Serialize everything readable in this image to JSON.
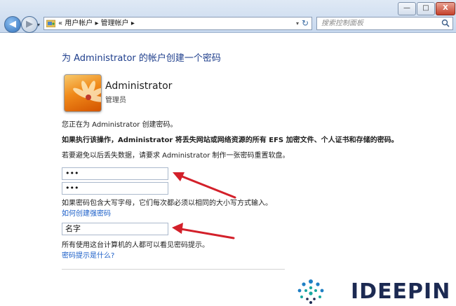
{
  "window": {
    "minimize_label": "—",
    "maximize_label": "□",
    "close_label": "X"
  },
  "nav": {
    "back_glyph": "◀",
    "forward_glyph": "▶",
    "dropdown_glyph": "▾"
  },
  "address_bar": {
    "crumbs": "« 用户帐户 ▸ 管理帐户 ▸",
    "dropdown_glyph": "▾",
    "refresh_glyph": "↻"
  },
  "search": {
    "placeholder": "搜索控制面板"
  },
  "page": {
    "title": "为 Administrator 的帐户创建一个密码",
    "user_name": "Administrator",
    "user_role": "管理员",
    "line_creating": "您正在为 Administrator 创建密码。",
    "warning": "如果执行该操作，Administrator 将丢失网站或网络资源的所有 EFS 加密文件、个人证书和存储的密码。",
    "reset_disk_hint": "若要避免以后丢失数据，请要求 Administrator 制作一张密码重置软盘。",
    "password_value": "•••",
    "confirm_value": "•••",
    "case_hint": "如果密码包含大写字母，它们每次都必须以相同的大小写方式输入。",
    "strong_password_link": "如何创建强密码",
    "hint_value": "名字",
    "hint_visibility": "所有使用这台计算机的人都可以看见密码提示。",
    "hint_help_link": "密码提示是什么?"
  },
  "watermark": {
    "brand": "IDEEPIN"
  },
  "colors": {
    "arrow": "#d3202a",
    "title": "#1e3e8c",
    "link": "#1a5ec8"
  }
}
